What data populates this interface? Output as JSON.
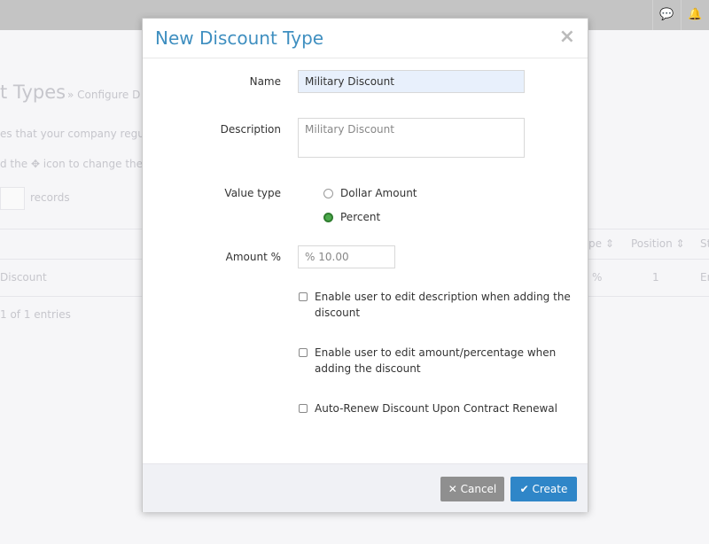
{
  "topbar": {
    "icons": [
      "chat-icon",
      "bell-icon"
    ]
  },
  "background": {
    "page_title_fragment": "t Types",
    "breadcrumb": "» Configure D",
    "line1": "es that your company regula",
    "line2": "d the ✥ icon to change the o",
    "records_label": "records",
    "row_name": "Discount",
    "footer": "1 of 1 entries",
    "col_type": "pe ⇕",
    "col_position": "Position ⇕",
    "col_status": "St",
    "cell_type": "%",
    "cell_position": "1",
    "cell_status": "Er"
  },
  "modal": {
    "title": "New Discount Type",
    "close": "×",
    "name_label": "Name",
    "name_value": "Military Discount",
    "description_label": "Description",
    "description_value": "Military Discount",
    "value_type_label": "Value type",
    "value_types": [
      {
        "label": "Dollar Amount",
        "selected": false
      },
      {
        "label": "Percent",
        "selected": true
      }
    ],
    "amount_label": "Amount %",
    "amount_prefix": "%",
    "amount_value": "10.00",
    "checkboxes": [
      {
        "label": "Enable user to edit description when adding the discount",
        "checked": false
      },
      {
        "label": "Enable user to edit amount/percentage when adding the discount",
        "checked": false
      },
      {
        "label": "Auto-Renew Discount Upon Contract Renewal",
        "checked": false
      }
    ],
    "cancel_label": "Cancel",
    "create_label": "Create"
  },
  "colors": {
    "accent": "#3f8fc0",
    "create": "#2f86c8",
    "cancel": "#8f8f8f",
    "radio_selected": "#4caa4c"
  }
}
